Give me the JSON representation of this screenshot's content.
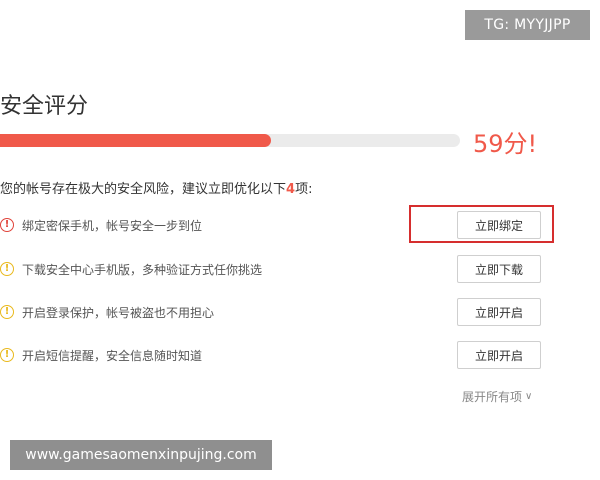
{
  "watermark_top": "TG: MYYJJPP",
  "title": "安全评分",
  "progress": {
    "percent": 59
  },
  "score": {
    "value": "59分",
    "suffix": "!"
  },
  "summary": {
    "prefix": "您的帐号存在极大的安全风险，建议立即优化以下",
    "count": "4",
    "suffix": "项:"
  },
  "items": [
    {
      "text": "绑定密保手机，帐号安全一步到位",
      "button": "立即绑定",
      "level": "red"
    },
    {
      "text": "下载安全中心手机版，多种验证方式任你挑选",
      "button": "立即下载",
      "level": "yellow"
    },
    {
      "text": "开启登录保护，帐号被盗也不用担心",
      "button": "立即开启",
      "level": "yellow"
    },
    {
      "text": "开启短信提醒，安全信息随时知道",
      "button": "立即开启",
      "level": "yellow"
    }
  ],
  "expand_label": "展开所有项",
  "watermark_bottom": "www.gamesaomenxinpujing.com",
  "colors": {
    "accent": "#f0594a",
    "warn_yellow": "#e9b91e",
    "warn_red": "#e0433a",
    "highlight": "#d62e2e"
  },
  "icons": {
    "warning": "exclamation-circle-icon",
    "expand": "chevron-down-icon"
  }
}
